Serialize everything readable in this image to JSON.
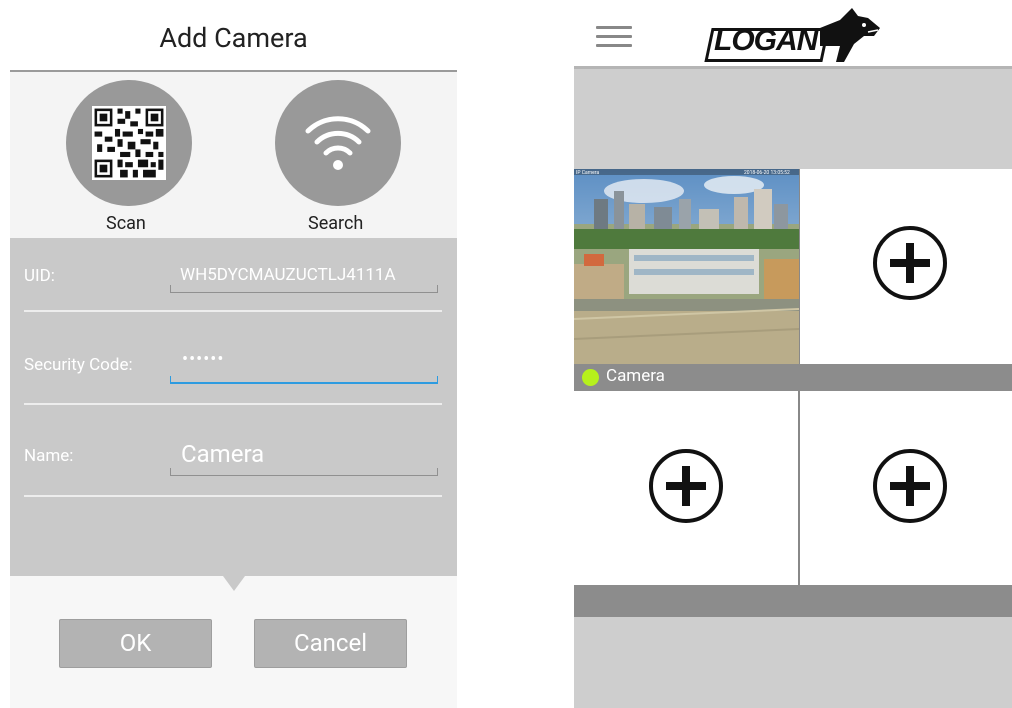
{
  "dialog": {
    "title": "Add Camera",
    "scan_label": "Scan",
    "search_label": "Search",
    "fields": {
      "uid_label": "UID:",
      "uid_value": "WH5DYCMAUZUCTLJ4111A",
      "security_label": "Security Code:",
      "security_value": "••••••",
      "name_label": "Name:",
      "name_value": "Camera"
    },
    "ok_label": "OK",
    "cancel_label": "Cancel"
  },
  "viewer": {
    "brand": "LOGAN",
    "camera_name": "Camera",
    "thumb_overlay_left": "IP Camera",
    "thumb_overlay_right": "2018-06-20 13:05:52",
    "status_color": "#b6f01c"
  },
  "icons": [
    "qr-code-icon",
    "wifi-icon",
    "menu-icon",
    "add-camera-icon"
  ]
}
